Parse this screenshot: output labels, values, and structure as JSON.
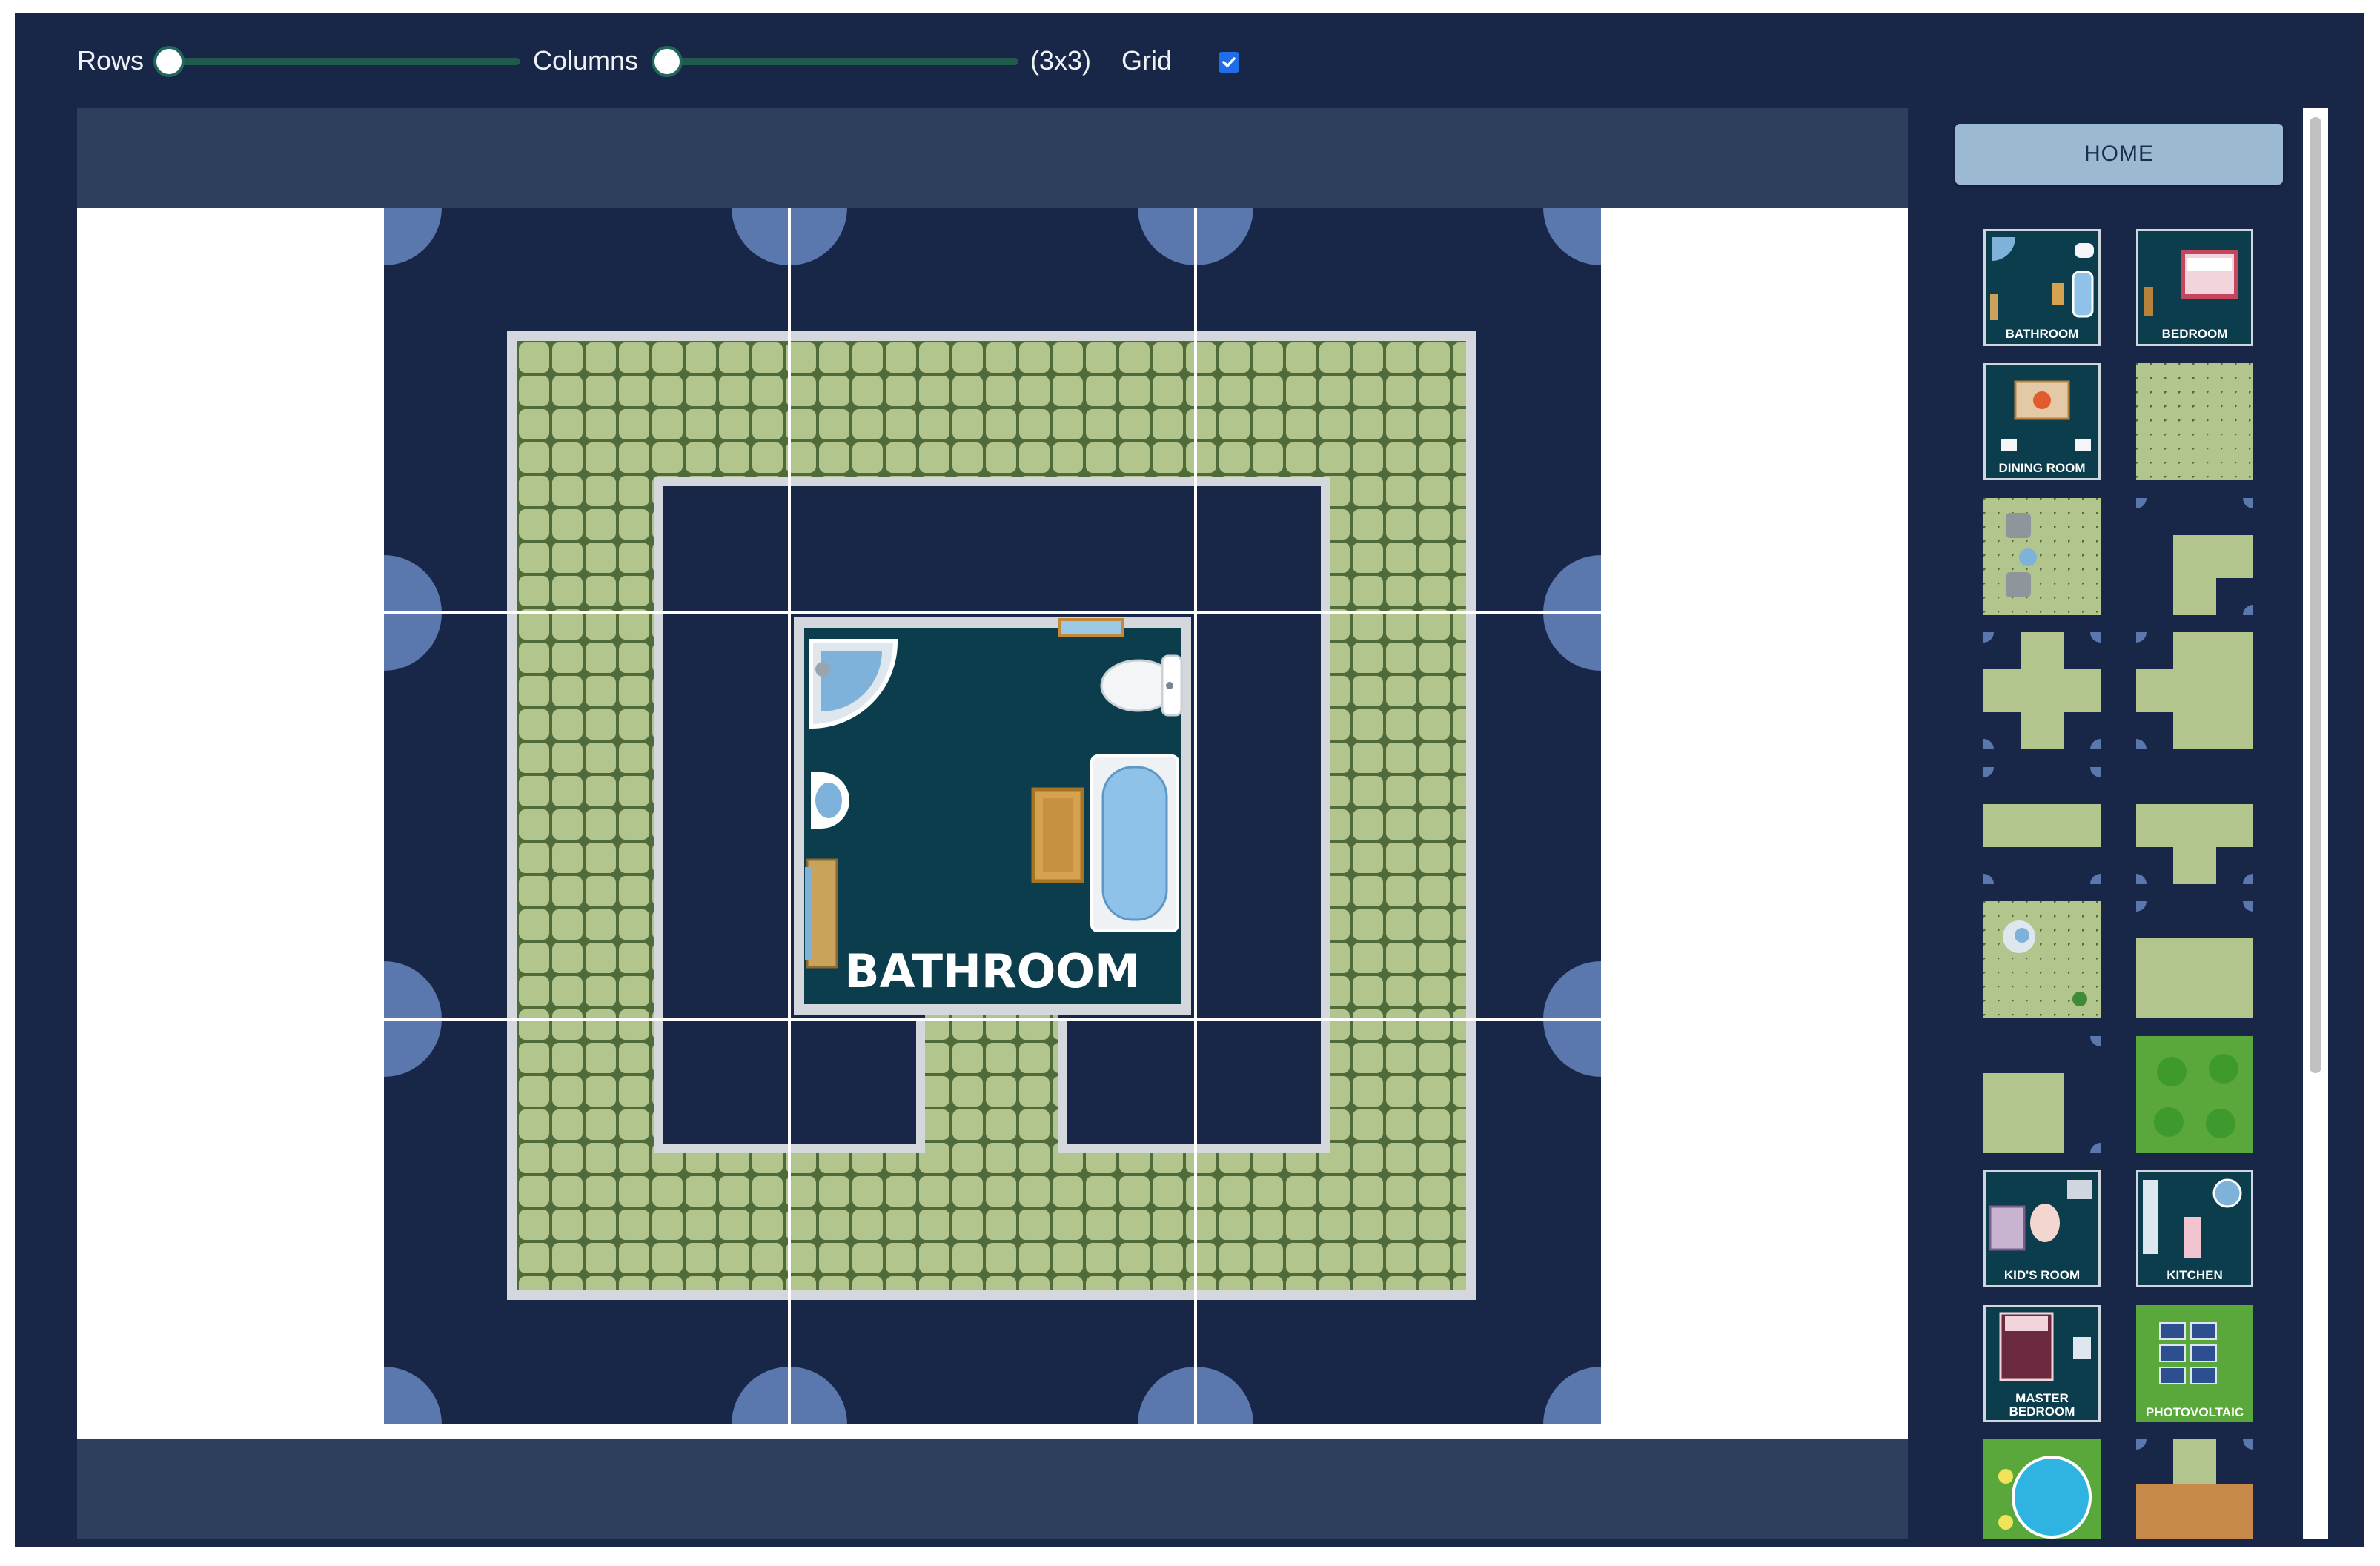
{
  "toolbar": {
    "rows_label": "Rows",
    "columns_label": "Columns",
    "grid_size": "(3x3)",
    "grid_label": "Grid",
    "grid_checked": true,
    "rows_value_fraction": 0,
    "columns_value_fraction": 0
  },
  "board": {
    "room_title": "BATHROOM"
  },
  "palette": {
    "home_label": "HOME",
    "tiles": [
      {
        "label": "BATHROOM",
        "kind": "room"
      },
      {
        "label": "BEDROOM",
        "kind": "room"
      },
      {
        "label": "DINING ROOM",
        "kind": "room"
      },
      {
        "label": "",
        "kind": "floor-tiles"
      },
      {
        "label": "",
        "kind": "floor-tiles-furniture"
      },
      {
        "label": "",
        "kind": "corner-path"
      },
      {
        "label": "",
        "kind": "cross-path"
      },
      {
        "label": "",
        "kind": "t-path"
      },
      {
        "label": "",
        "kind": "straight-path"
      },
      {
        "label": "",
        "kind": "t-path-down"
      },
      {
        "label": "",
        "kind": "floor-tiles-plants"
      },
      {
        "label": "",
        "kind": "floor-tiles-edge"
      },
      {
        "label": "",
        "kind": "corner-tiles"
      },
      {
        "label": "",
        "kind": "garden"
      },
      {
        "label": "KID'S ROOM",
        "kind": "room"
      },
      {
        "label": "KITCHEN",
        "kind": "room"
      },
      {
        "label": "MASTER BEDROOM",
        "kind": "room"
      },
      {
        "label": "PHOTOVOLTAIC",
        "kind": "solar"
      },
      {
        "label": "",
        "kind": "pool"
      },
      {
        "label": "",
        "kind": "entrance"
      }
    ]
  },
  "colors": {
    "background": "#182747",
    "tile_green": "#b2c58c",
    "room_teal": "#0b3d4c",
    "accent_checkbox": "#1d6ee8",
    "home_button": "#9bbad1"
  }
}
